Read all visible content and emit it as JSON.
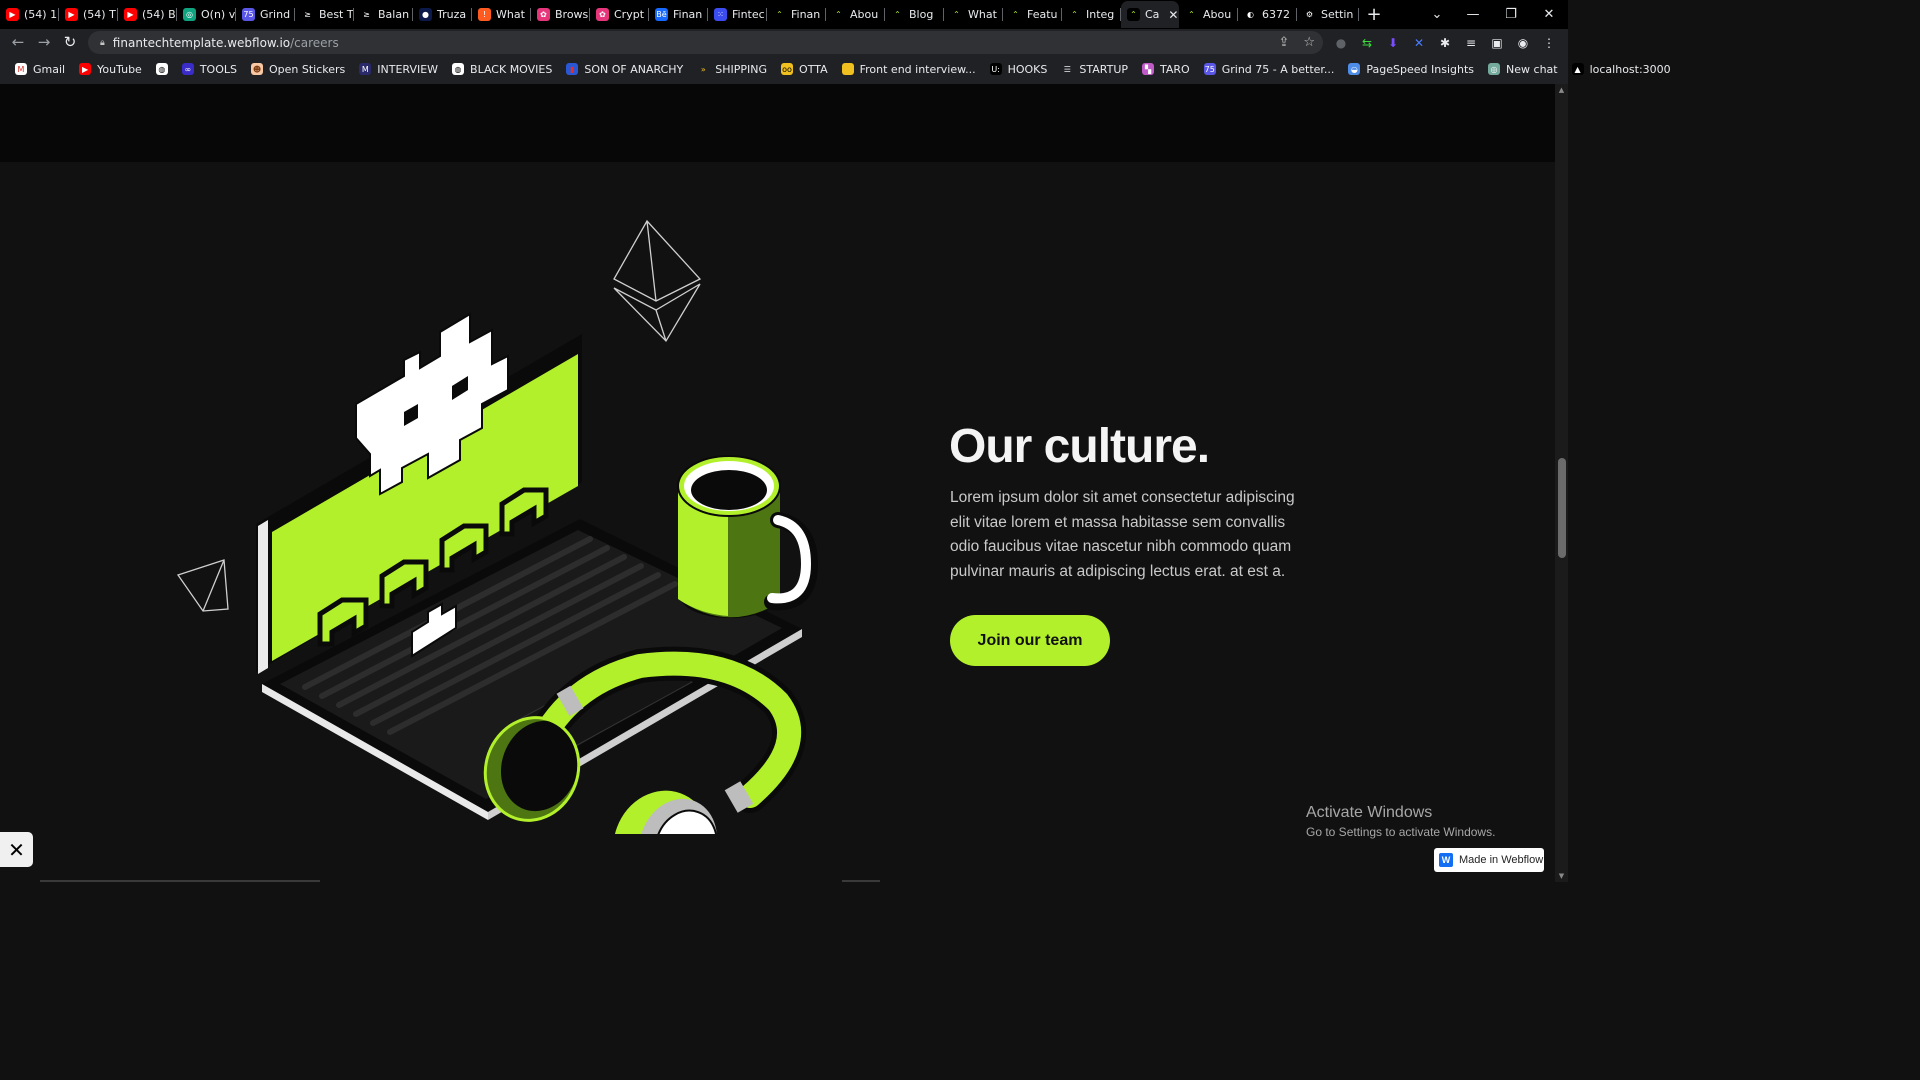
{
  "browser": {
    "tabs": [
      {
        "label": "(54) 1",
        "fav_color": "#ff0000",
        "fav_glyph": "▶"
      },
      {
        "label": "(54) T",
        "fav_color": "#ff0000",
        "fav_glyph": "▶"
      },
      {
        "label": "(54) B",
        "fav_color": "#ff0000",
        "fav_glyph": "▶"
      },
      {
        "label": "O(n) v",
        "fav_color": "#10a37f",
        "fav_glyph": "◎"
      },
      {
        "label": "Grind",
        "fav_color": "#5a57e6",
        "fav_glyph": "75"
      },
      {
        "label": "Best T",
        "fav_color": "#000000",
        "fav_glyph": "≥"
      },
      {
        "label": "Balan",
        "fav_color": "#000000",
        "fav_glyph": "≥"
      },
      {
        "label": "Truza",
        "fav_color": "#0b1a4a",
        "fav_glyph": "●"
      },
      {
        "label": "What",
        "fav_color": "#ff5a1f",
        "fav_glyph": "!"
      },
      {
        "label": "Brows",
        "fav_color": "#e6357a",
        "fav_glyph": "✿"
      },
      {
        "label": "Crypt",
        "fav_color": "#e6357a",
        "fav_glyph": "✿"
      },
      {
        "label": "Finan",
        "fav_color": "#1769ff",
        "fav_glyph": "Bē"
      },
      {
        "label": "Fintec",
        "fav_color": "#3b4cf0",
        "fav_glyph": "⁙"
      },
      {
        "label": "Finan",
        "fav_color": "#000000",
        "fav_glyph": "⌃"
      },
      {
        "label": "Abou",
        "fav_color": "#000000",
        "fav_glyph": "⌃"
      },
      {
        "label": "Blog",
        "fav_color": "#000000",
        "fav_glyph": "⌃"
      },
      {
        "label": "What",
        "fav_color": "#000000",
        "fav_glyph": "⌃"
      },
      {
        "label": "Featu",
        "fav_color": "#000000",
        "fav_glyph": "⌃"
      },
      {
        "label": "Integ",
        "fav_color": "#000000",
        "fav_glyph": "⌃"
      },
      {
        "label": "Ca",
        "fav_color": "#000000",
        "fav_glyph": "⌃",
        "active": true
      },
      {
        "label": "Abou",
        "fav_color": "#000000",
        "fav_glyph": "⌃"
      },
      {
        "label": "6372",
        "fav_color": "#000000",
        "fav_glyph": "◐"
      },
      {
        "label": "Settin",
        "fav_color": "#000000",
        "fav_glyph": "⚙"
      }
    ],
    "new_tab_glyph": "+",
    "tab_close_glyph": "✕",
    "window_controls": {
      "tab_search": "⌄",
      "minimize": "—",
      "restore": "❐",
      "close": "✕"
    },
    "nav": {
      "back": "←",
      "forward": "→",
      "reload": "↻"
    },
    "url_host": "finantechtemplate.webflow.io",
    "url_path": "/careers",
    "lock_glyph": "🔒︎",
    "omnibox_icons": {
      "share": "⇪",
      "star": "☆"
    },
    "extensions": [
      "●",
      "⇆",
      "⬇",
      "✕",
      "✱",
      "≡",
      "▣",
      "◉",
      "⋮"
    ],
    "bookmarks": [
      {
        "label": "Gmail",
        "fav_color": "#ffffff",
        "fav_glyph": "M",
        "glyph_color": "#d93025"
      },
      {
        "label": "YouTube",
        "fav_color": "#ff0000",
        "fav_glyph": "▶",
        "glyph_color": "#ffffff"
      },
      {
        "label": "",
        "fav_color": "#ffffff",
        "fav_glyph": "◍",
        "glyph_color": "#000000"
      },
      {
        "label": "TOOLS",
        "fav_color": "#3a2cc8",
        "fav_glyph": "∞",
        "glyph_color": "#ffffff"
      },
      {
        "label": "Open Stickers",
        "fav_color": "#f7c8a3",
        "fav_glyph": "☻",
        "glyph_color": "#7a3b12"
      },
      {
        "label": "INTERVIEW",
        "fav_color": "#2a2a6a",
        "fav_glyph": "M",
        "glyph_color": "#ffffff"
      },
      {
        "label": "BLACK MOVIES",
        "fav_color": "#ffffff",
        "fav_glyph": "◍",
        "glyph_color": "#000000"
      },
      {
        "label": "SON OF ANARCHY",
        "fav_color": "#2a58d4",
        "fav_glyph": "▮",
        "glyph_color": "#e03030"
      },
      {
        "label": "SHIPPING",
        "fav_color": "#202124",
        "fav_glyph": "»",
        "glyph_color": "#f0c020"
      },
      {
        "label": "OTTA",
        "fav_color": "#f0c020",
        "fav_glyph": "oo",
        "glyph_color": "#000000"
      },
      {
        "label": "Front end interview...",
        "fav_color": "#f0c020",
        "fav_glyph": "▮",
        "glyph_color": "#f0c020"
      },
      {
        "label": "HOOKS",
        "fav_color": "#000000",
        "fav_glyph": "U:",
        "glyph_color": "#ffffff"
      },
      {
        "label": "STARTUP",
        "fav_color": "#202124",
        "fav_glyph": "☰",
        "glyph_color": "#e8eaed"
      },
      {
        "label": "TARO",
        "fav_color": "#c05ac8",
        "fav_glyph": "▚",
        "glyph_color": "#ffffff"
      },
      {
        "label": "Grind 75 - A better...",
        "fav_color": "#5a57e6",
        "fav_glyph": "75",
        "glyph_color": "#ffffff"
      },
      {
        "label": "PageSpeed Insights",
        "fav_color": "#4e8de8",
        "fav_glyph": "◒",
        "glyph_color": "#ffffff"
      },
      {
        "label": "New chat",
        "fav_color": "#74aa9c",
        "fav_glyph": "◎",
        "glyph_color": "#ffffff"
      },
      {
        "label": "localhost:3000",
        "fav_color": "#000000",
        "fav_glyph": "▲",
        "glyph_color": "#ffffff"
      }
    ]
  },
  "page": {
    "section_title": "Our culture.",
    "section_body": "Lorem ipsum dolor sit amet consectetur adipiscing elit vitae lorem et massa habitasse sem convallis odio faucibus vitae nascetur nibh commodo quam pulvinar mauris at adipiscing lectus erat. at est a.",
    "cta_label": "Join our team",
    "accent_color": "#b3f02c",
    "background_color": "#111111",
    "illustration_icon": "laptop-mug-headphones-illustration"
  },
  "overlays": {
    "activate_title": "Activate Windows",
    "activate_subtitle": "Go to Settings to activate Windows.",
    "webflow_badge": "Made in Webflow",
    "webflow_logo": "W",
    "close_glyph": "✕"
  }
}
